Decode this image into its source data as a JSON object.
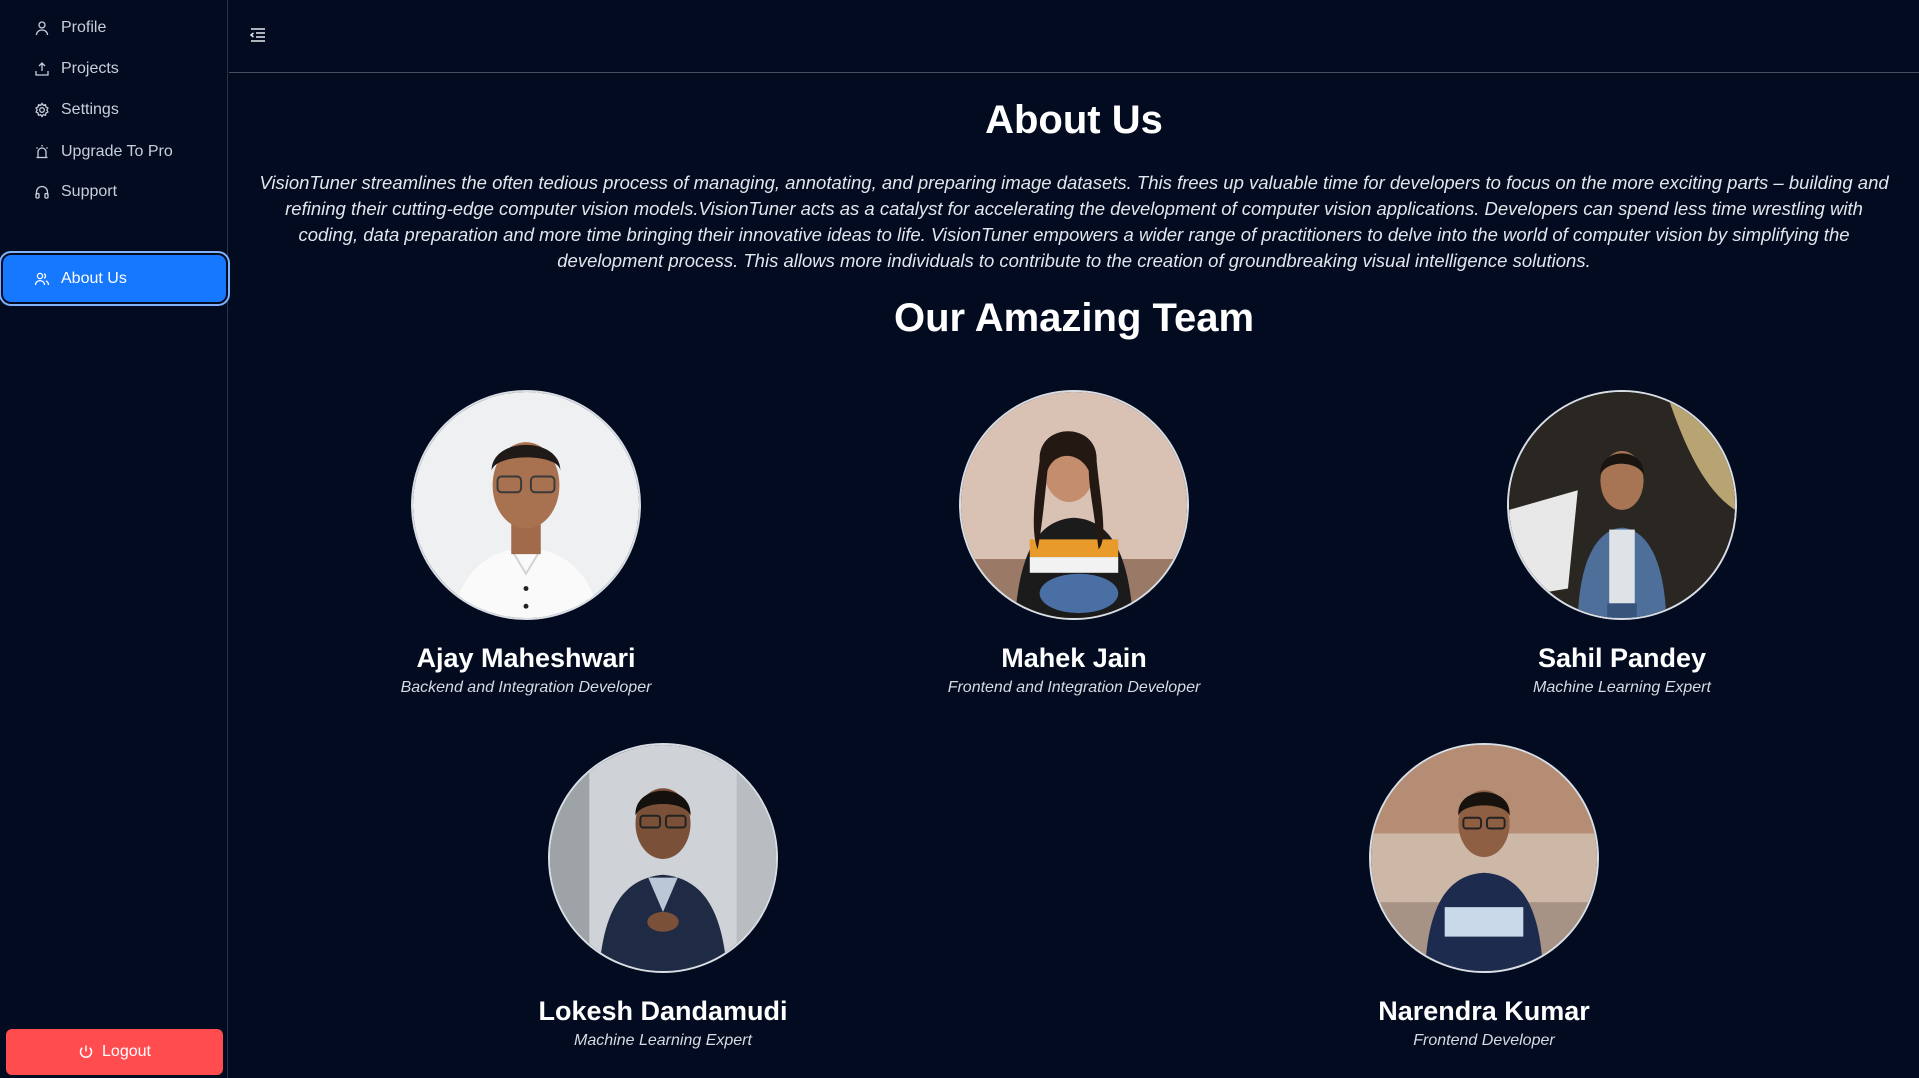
{
  "sidebar": {
    "items": [
      {
        "label": "Profile",
        "icon": "user-icon"
      },
      {
        "label": "Projects",
        "icon": "upload-icon"
      },
      {
        "label": "Settings",
        "icon": "gear-icon"
      },
      {
        "label": "Upgrade To Pro",
        "icon": "alarm-icon"
      },
      {
        "label": "Support",
        "icon": "headphones-icon"
      },
      {
        "label": "About Us",
        "icon": "team-icon",
        "active": true
      }
    ],
    "logout_label": "Logout"
  },
  "header": {
    "menu_icon": "menu-fold-icon"
  },
  "main": {
    "title": "About Us",
    "description": "VisionTuner streamlines the often tedious process of managing, annotating, and preparing image datasets. This frees up valuable time for developers to focus on the more exciting parts – building and refining their cutting-edge computer vision models.VisionTuner acts as a catalyst for accelerating the development of computer vision applications. Developers can spend less time wrestling with coding, data preparation and more time bringing their innovative ideas to life. VisionTuner empowers a wider range of practitioners to delve into the world of computer vision by simplifying the development process. This allows more individuals to contribute to the creation of groundbreaking visual intelligence solutions.",
    "team_title": "Our Amazing Team",
    "team": [
      {
        "name": "Ajay Maheshwari",
        "role": "Backend and Integration Developer"
      },
      {
        "name": "Mahek Jain",
        "role": "Frontend and Integration Developer"
      },
      {
        "name": "Sahil Pandey",
        "role": "Machine Learning Expert"
      },
      {
        "name": "Lokesh Dandamudi",
        "role": "Machine Learning Expert"
      },
      {
        "name": "Narendra Kumar",
        "role": "Frontend Developer"
      }
    ]
  },
  "colors": {
    "background": "#020b1f",
    "accent": "#1677ff",
    "danger": "#ff4d4f"
  }
}
